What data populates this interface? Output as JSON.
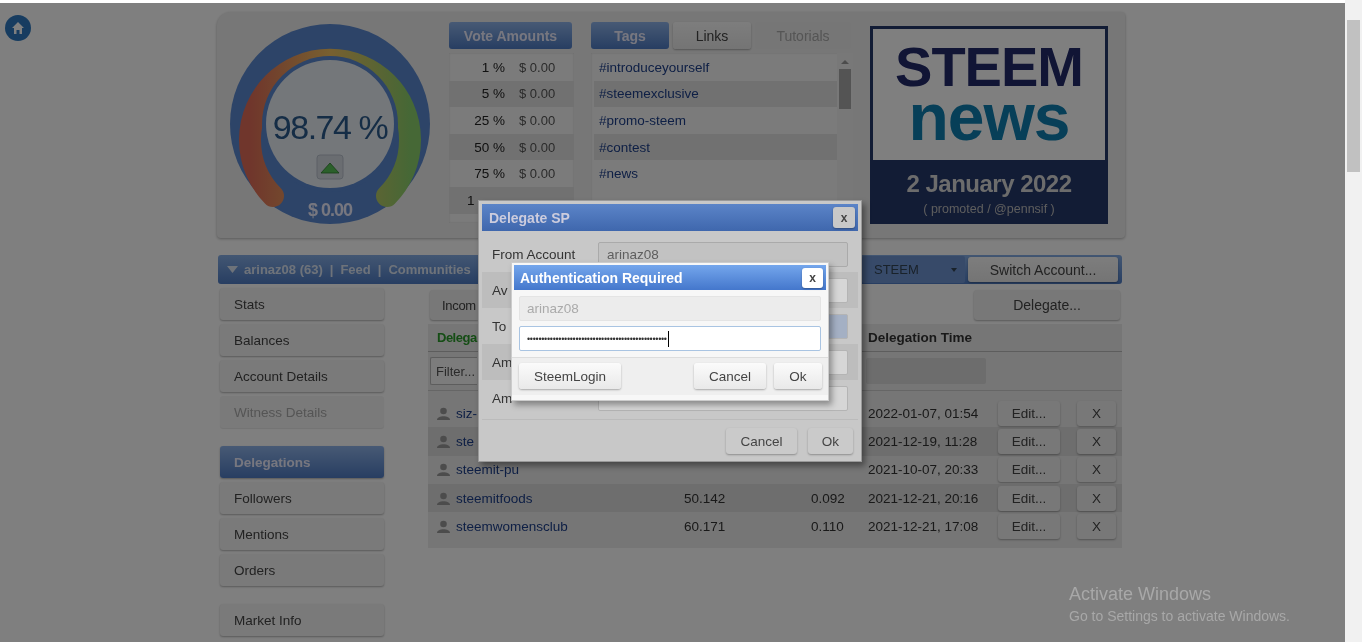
{
  "gauge": {
    "percent": "98.74 %",
    "value": "$ 0.00"
  },
  "vote_amounts": {
    "title": "Vote Amounts",
    "rows": [
      {
        "percent": "1 %",
        "value": "$ 0.00"
      },
      {
        "percent": "5 %",
        "value": "$ 0.00"
      },
      {
        "percent": "25 %",
        "value": "$ 0.00"
      },
      {
        "percent": "50 %",
        "value": "$ 0.00"
      },
      {
        "percent": "75 %",
        "value": "$ 0.00"
      },
      {
        "percent": "1"
      }
    ]
  },
  "tags_panel": {
    "tabs": [
      {
        "label": "Tags",
        "selected": true,
        "disabled": false
      },
      {
        "label": "Links",
        "selected": false,
        "disabled": false
      },
      {
        "label": "Tutorials",
        "selected": false,
        "disabled": true
      }
    ],
    "tags": [
      "#introduceyourself",
      "#steemexclusive",
      "#promo-steem",
      "#contest",
      "#news"
    ]
  },
  "news_banner": {
    "logo_top": "STEEM",
    "logo_bottom": "news",
    "date": "2 January 2022",
    "credit": "( promoted / @pennsif )"
  },
  "nav": {
    "items": [
      {
        "kind": "link",
        "text": "arinaz08 (63)"
      },
      {
        "kind": "separator",
        "text": "|"
      },
      {
        "kind": "link",
        "text": "Feed"
      },
      {
        "kind": "separator",
        "text": "|"
      },
      {
        "kind": "link",
        "text": "Communities"
      }
    ],
    "currency": "STEEM",
    "switch_button": "Switch Account..."
  },
  "sidebar": {
    "groups": [
      {
        "items": [
          {
            "label": "Stats",
            "selected": false,
            "disabled": false
          },
          {
            "label": "Balances",
            "selected": false,
            "disabled": false
          },
          {
            "label": "Account Details",
            "selected": false,
            "disabled": false
          },
          {
            "label": "Witness Details",
            "selected": false,
            "disabled": true
          }
        ]
      },
      {
        "items": [
          {
            "label": "Delegations",
            "selected": true,
            "disabled": false
          },
          {
            "label": "Followers",
            "selected": false,
            "disabled": false
          },
          {
            "label": "Mentions",
            "selected": false,
            "disabled": false
          },
          {
            "label": "Orders",
            "selected": false,
            "disabled": false
          }
        ]
      },
      {
        "items": [
          {
            "label": "Market Info",
            "selected": false,
            "disabled": false
          }
        ]
      }
    ]
  },
  "delegations": {
    "tab": "Incom",
    "delegate_button": "Delegate...",
    "columns": [
      "Delega",
      "Delegation Time"
    ],
    "filter_placeholder": "Filter...",
    "rows": [
      {
        "account": "siz-",
        "time": "2022-01-07, 01:54",
        "edit": "Edit...",
        "remove": "X"
      },
      {
        "account": "ste",
        "time": "2021-12-19, 11:28",
        "edit": "Edit...",
        "remove": "X"
      },
      {
        "account": "steemit-pu",
        "time": "2021-10-07, 20:33",
        "edit": "Edit...",
        "remove": "X"
      },
      {
        "account": "steemitfoods",
        "amount": "50.142",
        "column_3": "0.092",
        "time": "2021-12-21, 20:16",
        "edit": "Edit...",
        "remove": "X"
      },
      {
        "account": "steemwomensclub",
        "amount": "60.171",
        "column_3": "0.110",
        "time": "2021-12-21, 17:08",
        "edit": "Edit...",
        "remove": "X"
      }
    ]
  },
  "delegate_dialog": {
    "title": "Delegate SP",
    "close": "x",
    "fields": [
      {
        "label": "From Account",
        "value": "arinaz08",
        "disabled": true
      },
      {
        "label": "Av",
        "disabled": false
      },
      {
        "label": "To",
        "disabled": false
      },
      {
        "label": "Am",
        "disabled": false
      },
      {
        "label": "Am",
        "disabled": false
      }
    ],
    "buttons": [
      "Cancel",
      "Ok"
    ]
  },
  "auth_dialog": {
    "title": "Authentication Required",
    "close": "x",
    "account": "arinaz08",
    "password": "•••••••••••••••••••••••••••••••••••••••••••••••••",
    "buttons": [
      "SteemLogin",
      "Cancel",
      "Ok"
    ]
  },
  "os_notice": {
    "title": "Activate Windows",
    "text": "Go to Settings to activate Windows."
  }
}
